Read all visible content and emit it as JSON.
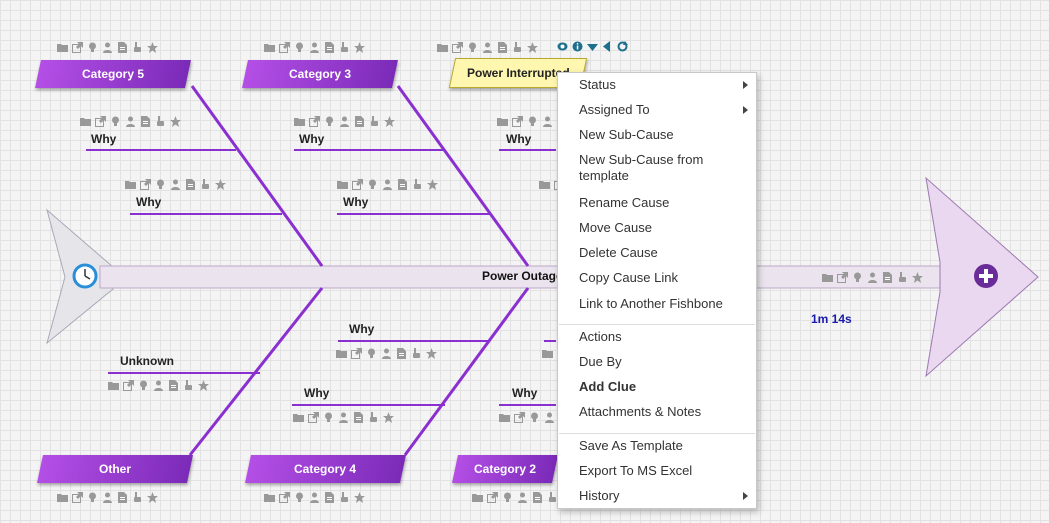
{
  "colors": {
    "accent": "#8a2fd0",
    "bone": "#7a24c6",
    "effect_bg": "#fff7b0",
    "timer": "#1a1aaa"
  },
  "categories": {
    "cat5": "Category 5",
    "cat3": "Category 3",
    "other": "Other",
    "cat4": "Category 4",
    "cat2": "Category 2",
    "effect": "Power Interrupted"
  },
  "spine": {
    "head_label": "Power Outage",
    "timer": "1m 14s"
  },
  "why": {
    "w1": "Why",
    "w2": "Why",
    "w3": "Why",
    "w4": "Why",
    "w5": "Why",
    "w6": "Why",
    "w7": "Why",
    "w8": "Why",
    "w9": "Why",
    "unknown": "Unknown"
  },
  "icons": [
    "folder-icon",
    "external-link-icon",
    "lightbulb-icon",
    "person-icon",
    "document-icon",
    "hand-icon",
    "star-icon"
  ],
  "menu": {
    "items": [
      {
        "label": "Status",
        "submenu": true
      },
      {
        "label": "Assigned To",
        "submenu": true
      },
      {
        "label": "New Sub-Cause"
      },
      {
        "label": "New Sub-Cause from template"
      },
      {
        "label": "Rename Cause"
      },
      {
        "label": "Move Cause"
      },
      {
        "label": "Delete Cause"
      },
      {
        "label": "Copy Cause Link"
      },
      {
        "label": "Link to Another Fishbone"
      },
      {
        "label": "Actions"
      },
      {
        "label": "Due By"
      },
      {
        "label": "Add Clue",
        "bold": true
      },
      {
        "label": "Attachments & Notes"
      },
      {
        "label": "Save As Template"
      },
      {
        "label": "Export To MS Excel"
      },
      {
        "label": "History",
        "submenu": true
      }
    ]
  }
}
